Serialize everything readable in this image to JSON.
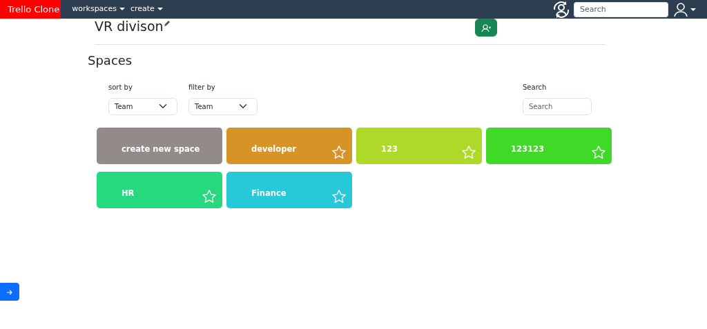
{
  "navbar": {
    "brand": "Trello Clone",
    "menus": [
      {
        "label": "workspaces"
      },
      {
        "label": "create"
      }
    ],
    "search": {
      "placeholder": "Search"
    }
  },
  "workspace": {
    "title": "VR divison"
  },
  "section_title": "Spaces",
  "controls": {
    "sort": {
      "label": "sort by",
      "value": "Team"
    },
    "filter": {
      "label": "filter by",
      "value": "Team"
    },
    "search": {
      "label": "Search",
      "placeholder": "Search"
    }
  },
  "spaces": [
    {
      "kind": "create",
      "name": "create new space",
      "color": "#938a8a"
    },
    {
      "kind": "space",
      "name": "developer",
      "color": "#d69326",
      "starred": false
    },
    {
      "kind": "space",
      "name": "123",
      "color": "#afd928",
      "starred": false
    },
    {
      "kind": "space",
      "name": "123123",
      "color": "#40d928",
      "starred": false
    },
    {
      "kind": "space",
      "name": "HR",
      "color": "#27d97e",
      "starred": false
    },
    {
      "kind": "space",
      "name": "Finance",
      "color": "#27c9d9",
      "starred": false
    }
  ]
}
